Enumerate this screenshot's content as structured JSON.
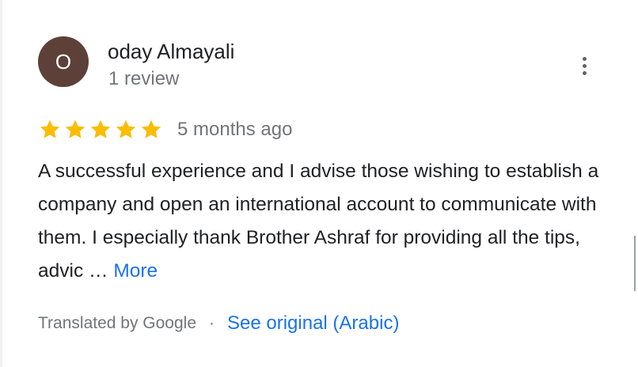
{
  "review": {
    "author": {
      "initial": "O",
      "name": "oday Almayali",
      "review_count": "1 review",
      "avatar_color": "#5d4037"
    },
    "rating": 5,
    "rating_max": 5,
    "star_color": "#fbbc04",
    "time_ago": "5 months ago",
    "text": "A successful experience and I advise those wishing to establish a company and open an international account to communicate with them. I especially thank Brother Ashraf for providing all the tips, advic … ",
    "more_label": "More",
    "translated_by": "Translated by Google",
    "separator": "·",
    "see_original_label": "See original (Arabic)",
    "link_color": "#1a73e8",
    "more_options_icon": "more-vert-icon"
  }
}
